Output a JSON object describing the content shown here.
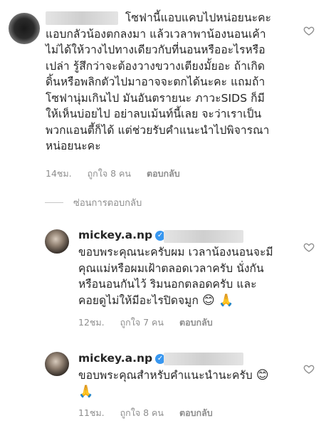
{
  "comments": [
    {
      "text": "โซฟานี้แอบแคบไปหน่อยนะคะ\nแอบกลัวน้องตกลงมา แล้วเวลาพาน้องนอนเค้า\nไม่ได้ให้วางไปทางเดียวกับที่นอนหรืออะไรหรือ\nเปล่า รู้สึกว่าจะต้องวางขวางเตียงมั้ยอะ ถ้าเกิด\nดิ้นหรือพลิกตัวไปมาอาจจะตกได้นะคะ แถมถ้า\nโซฟานุ่มเกินไป มันอันตรายนะ ภาวะSIDS ก็มี\nให้เห็นบ่อยไป อย่าลบเม้นท์นี้เลย จะว่าเราเป็น\nพวกแอนตี้ก็ได้ แต่ช่วยรับคำแนะนำไปพิจารณา\nหน่อยนะคะ",
      "time": "14ชม.",
      "likes": "ถูกใจ 8 คน",
      "reply": "ตอบกลับ"
    }
  ],
  "hide_replies": "ซ่อนการตอบกลับ",
  "replies": [
    {
      "username": "mickey.a.np",
      "text": "ขอบพระคุณนะครับผม เวลาน้องนอนจะมี\nคุณแม่หรือผมเฝ้าตลอดเวลาครับ นั่งกัน\nหรือนอนกันไว้ ริมนอกตลอดครับ และ\nคอยดูไม่ให้มีอะไรปิดจมูก",
      "emoji": "😊 🙏",
      "time": "12ชม.",
      "likes": "ถูกใจ 7 คน",
      "reply": "ตอบกลับ"
    },
    {
      "username": "mickey.a.np",
      "text": "ขอบพระคุณสำหรับคำแนะนำนะครับ",
      "emoji_inline": "😊",
      "emoji_next": "🙏",
      "time": "11ชม.",
      "likes": "ถูกใจ 8 คน",
      "reply": "ตอบกลับ"
    }
  ],
  "icons": {
    "like": "heart-icon",
    "verified": "verified-badge-icon"
  }
}
